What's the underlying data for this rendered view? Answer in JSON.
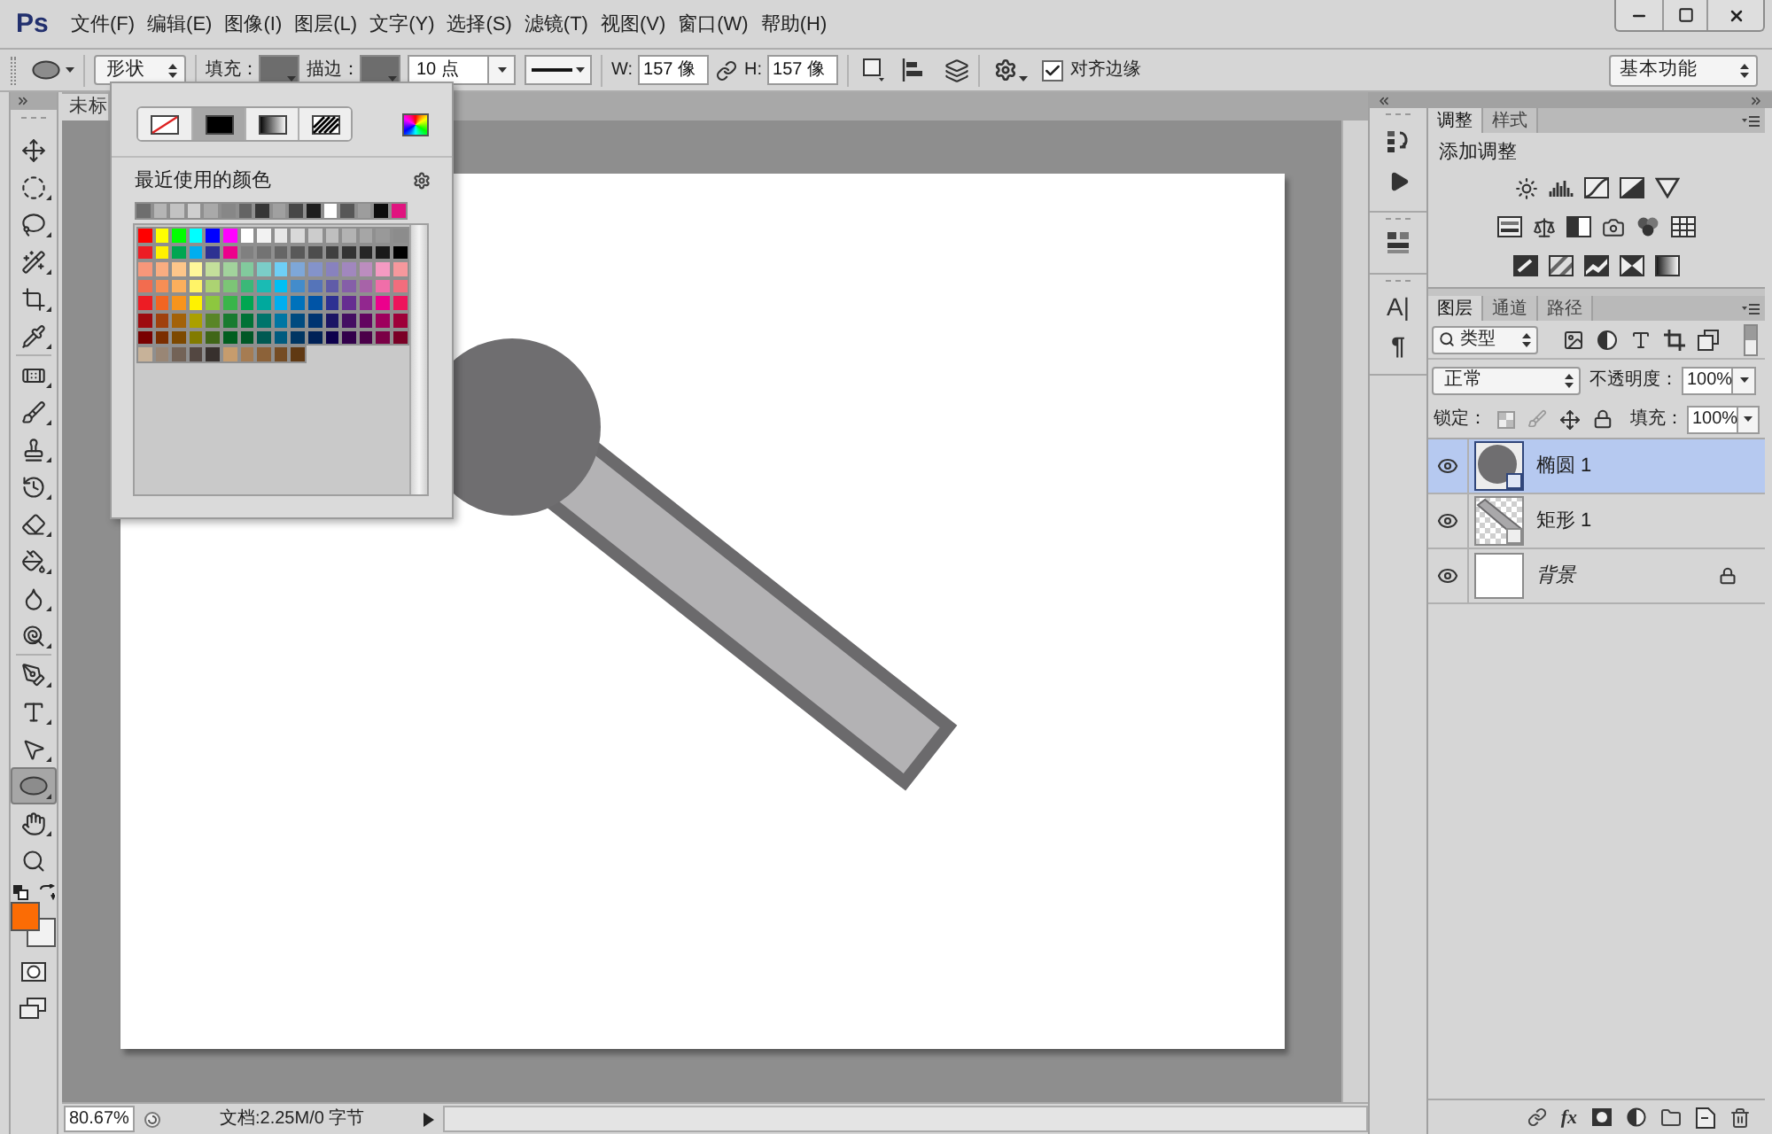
{
  "app": {
    "logo": "Ps"
  },
  "menu": [
    "文件(F)",
    "编辑(E)",
    "图像(I)",
    "图层(L)",
    "文字(Y)",
    "选择(S)",
    "滤镜(T)",
    "视图(V)",
    "窗口(W)",
    "帮助(H)"
  ],
  "options_bar": {
    "mode": "形状",
    "fill_label": "填充：",
    "stroke_label": "描边：",
    "stroke_width": "10 点",
    "w_label": "W:",
    "w_value": "157 像",
    "h_label": "H:",
    "h_value": "157 像",
    "align_edges": {
      "label": "对齐边缘",
      "checked": true
    },
    "workspace": "基本功能"
  },
  "document": {
    "tab": "未标"
  },
  "toolbar": {
    "tool_groups": [
      [
        {
          "kind": "move",
          "selected": false
        },
        {
          "kind": "marquee",
          "selected": false
        },
        {
          "kind": "lasso",
          "selected": false
        },
        {
          "kind": "quick_select",
          "selected": false
        },
        {
          "kind": "crop",
          "selected": false
        },
        {
          "kind": "eyedropper",
          "selected": false
        }
      ],
      [
        {
          "kind": "healing",
          "selected": false
        },
        {
          "kind": "brush",
          "selected": false
        },
        {
          "kind": "stamp",
          "selected": false
        },
        {
          "kind": "history_brush",
          "selected": false
        },
        {
          "kind": "eraser",
          "selected": false
        },
        {
          "kind": "bucket",
          "selected": false
        },
        {
          "kind": "blur",
          "selected": false
        },
        {
          "kind": "dodge",
          "selected": false
        }
      ],
      [
        {
          "kind": "pen",
          "selected": false
        },
        {
          "kind": "type",
          "selected": false
        },
        {
          "kind": "path_select",
          "selected": false
        },
        {
          "kind": "ellipse",
          "selected": true
        },
        {
          "kind": "hand",
          "selected": false
        },
        {
          "kind": "zoom",
          "selected": false
        }
      ]
    ],
    "color_swatches": [
      {
        "kind": "foreground",
        "color": "#fb6c05"
      },
      {
        "kind": "background",
        "color": "#f2f2f2"
      }
    ]
  },
  "swatch_popup": {
    "fill_types": [
      {
        "kind": "none",
        "selected": false
      },
      {
        "kind": "solid",
        "selected": true
      },
      {
        "kind": "gradient",
        "selected": false
      },
      {
        "kind": "pattern",
        "selected": false
      }
    ],
    "recent_label": "最近使用的颜色",
    "recent_colors": [
      {
        "color": "#6e6e6e"
      },
      {
        "color": "#b5b5b5"
      },
      {
        "color": "#c2c2c2"
      },
      {
        "color": "#cfcfcf"
      },
      {
        "color": "#a9a9a9"
      },
      {
        "color": "#878787"
      },
      {
        "color": "#646464"
      },
      {
        "color": "#363636"
      },
      {
        "color": "#a0a0a0"
      },
      {
        "color": "#474747"
      },
      {
        "color": "#1e1e1e"
      },
      {
        "color": "#ffffff"
      },
      {
        "color": "#575757"
      },
      {
        "color": "#9d9d9d"
      },
      {
        "color": "#0d0d0d"
      },
      {
        "color": "#e0147f"
      }
    ],
    "swatches": [
      {
        "color": "#ff0000"
      },
      {
        "color": "#ffff00"
      },
      {
        "color": "#00ff00"
      },
      {
        "color": "#00ffff"
      },
      {
        "color": "#0000ff"
      },
      {
        "color": "#ff00ff"
      },
      {
        "color": "#ffffff"
      },
      {
        "color": "#f2f2f2"
      },
      {
        "color": "#e6e6e6"
      },
      {
        "color": "#d9d9d9"
      },
      {
        "color": "#cccccc"
      },
      {
        "color": "#bfbfbf"
      },
      {
        "color": "#b3b3b3"
      },
      {
        "color": "#a6a6a6"
      },
      {
        "color": "#999999"
      },
      {
        "color": "#8c8c8c"
      },
      {
        "color": "#ed1c24"
      },
      {
        "color": "#fff200"
      },
      {
        "color": "#00a651"
      },
      {
        "color": "#00aeef"
      },
      {
        "color": "#2e3192"
      },
      {
        "color": "#ec008c"
      },
      {
        "color": "#808080"
      },
      {
        "color": "#737373"
      },
      {
        "color": "#666666"
      },
      {
        "color": "#595959"
      },
      {
        "color": "#4d4d4d"
      },
      {
        "color": "#404040"
      },
      {
        "color": "#333333"
      },
      {
        "color": "#262626"
      },
      {
        "color": "#1a1a1a"
      },
      {
        "color": "#000000"
      },
      {
        "color": "#f7977a"
      },
      {
        "color": "#f9ad81"
      },
      {
        "color": "#fdc68a"
      },
      {
        "color": "#fff79a"
      },
      {
        "color": "#c4df9b"
      },
      {
        "color": "#a2d39c"
      },
      {
        "color": "#82ca9d"
      },
      {
        "color": "#7bcdc8"
      },
      {
        "color": "#6ecff6"
      },
      {
        "color": "#7ea7d8"
      },
      {
        "color": "#8493ca"
      },
      {
        "color": "#8882be"
      },
      {
        "color": "#a187be"
      },
      {
        "color": "#bc8dbf"
      },
      {
        "color": "#f49ac2"
      },
      {
        "color": "#f6989d"
      },
      {
        "color": "#f26c4f"
      },
      {
        "color": "#f68e55"
      },
      {
        "color": "#fbaf5c"
      },
      {
        "color": "#fff467"
      },
      {
        "color": "#acd372"
      },
      {
        "color": "#7cc576"
      },
      {
        "color": "#3bb878"
      },
      {
        "color": "#1abbb4"
      },
      {
        "color": "#00bff3"
      },
      {
        "color": "#438ccb"
      },
      {
        "color": "#5574b9"
      },
      {
        "color": "#605ca8"
      },
      {
        "color": "#855fa8"
      },
      {
        "color": "#a763a8"
      },
      {
        "color": "#f06ea9"
      },
      {
        "color": "#f26d7d"
      },
      {
        "color": "#ed1c24"
      },
      {
        "color": "#f26522"
      },
      {
        "color": "#f7941d"
      },
      {
        "color": "#fff200"
      },
      {
        "color": "#8dc73f"
      },
      {
        "color": "#39b54a"
      },
      {
        "color": "#00a651"
      },
      {
        "color": "#00a99d"
      },
      {
        "color": "#00aeef"
      },
      {
        "color": "#0072bc"
      },
      {
        "color": "#0054a6"
      },
      {
        "color": "#2e3192"
      },
      {
        "color": "#662d91"
      },
      {
        "color": "#92278f"
      },
      {
        "color": "#ec008c"
      },
      {
        "color": "#ed145b"
      },
      {
        "color": "#9e0b0f"
      },
      {
        "color": "#a0410d"
      },
      {
        "color": "#a36209"
      },
      {
        "color": "#aba000"
      },
      {
        "color": "#598527"
      },
      {
        "color": "#197b30"
      },
      {
        "color": "#007236"
      },
      {
        "color": "#00746b"
      },
      {
        "color": "#0076a3"
      },
      {
        "color": "#004b80"
      },
      {
        "color": "#003471"
      },
      {
        "color": "#1b1464"
      },
      {
        "color": "#440e62"
      },
      {
        "color": "#630460"
      },
      {
        "color": "#9e005d"
      },
      {
        "color": "#9e0039"
      },
      {
        "color": "#790000"
      },
      {
        "color": "#7b2e00"
      },
      {
        "color": "#7d4900"
      },
      {
        "color": "#827b00"
      },
      {
        "color": "#406618"
      },
      {
        "color": "#005e20"
      },
      {
        "color": "#005826"
      },
      {
        "color": "#005952"
      },
      {
        "color": "#005b7f"
      },
      {
        "color": "#003663"
      },
      {
        "color": "#002157"
      },
      {
        "color": "#0d004c"
      },
      {
        "color": "#32004b"
      },
      {
        "color": "#4b0049"
      },
      {
        "color": "#7b0046"
      },
      {
        "color": "#7a0026"
      },
      {
        "color": "#c7b299"
      },
      {
        "color": "#998675"
      },
      {
        "color": "#736357"
      },
      {
        "color": "#534741"
      },
      {
        "color": "#37302d"
      },
      {
        "color": "#c69c6d"
      },
      {
        "color": "#a67c52"
      },
      {
        "color": "#8c6239"
      },
      {
        "color": "#754c24"
      },
      {
        "color": "#603913"
      }
    ]
  },
  "dock": {
    "glyph_buttons": [
      "A|",
      "¶"
    ]
  },
  "adjustments_panel": {
    "tabs": [
      {
        "label": "调整",
        "selected": true
      },
      {
        "label": "样式",
        "selected": false
      }
    ],
    "title": "添加调整"
  },
  "layers_panel": {
    "tabs": [
      {
        "label": "图层",
        "selected": true
      },
      {
        "label": "通道",
        "selected": false
      },
      {
        "label": "路径",
        "selected": false
      }
    ],
    "filter": "类型",
    "blend_mode": "正常",
    "opacity_label": "不透明度：",
    "opacity": "100%",
    "lock_label": "锁定：",
    "fill_label": "填充：",
    "fill": "100%",
    "layers": [
      {
        "name": "椭圆 1",
        "kind": "ellipse",
        "selected": true,
        "visible": true,
        "locked": false
      },
      {
        "name": "矩形 1",
        "kind": "rectangle",
        "selected": false,
        "visible": true,
        "locked": false
      },
      {
        "name": "背景",
        "kind": "background",
        "selected": false,
        "visible": true,
        "locked": true
      }
    ],
    "effects_button": "fx"
  },
  "status_bar": {
    "zoom": "80.67%",
    "doc_info": "文档:2.25M/0 字节"
  }
}
